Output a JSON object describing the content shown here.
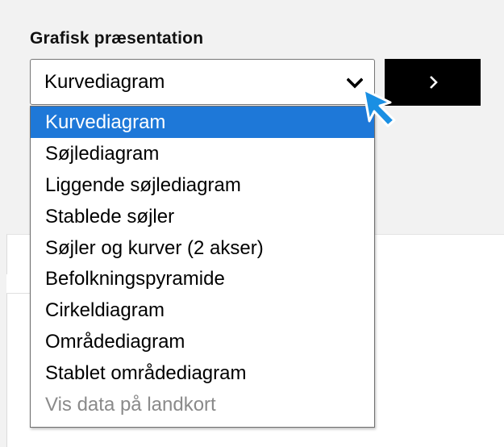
{
  "heading": "Grafisk præsentation",
  "select": {
    "value": "Kurvediagram",
    "chevron_icon": "chevron-down-icon"
  },
  "go_button": {
    "icon": "chevron-right-icon",
    "background": "#000000"
  },
  "dropdown": {
    "options": [
      {
        "label": "Kurvediagram",
        "state": "selected"
      },
      {
        "label": "Søjlediagram",
        "state": "enabled"
      },
      {
        "label": "Liggende søjlediagram",
        "state": "enabled"
      },
      {
        "label": "Stablede søjler",
        "state": "enabled"
      },
      {
        "label": "Søjler og kurver (2 akser)",
        "state": "enabled"
      },
      {
        "label": "Befolkningspyramide",
        "state": "enabled"
      },
      {
        "label": "Cirkeldiagram",
        "state": "enabled"
      },
      {
        "label": "Områdediagram",
        "state": "enabled"
      },
      {
        "label": "Stablet områdediagram",
        "state": "enabled"
      },
      {
        "label": "Vis data på landkort",
        "state": "disabled"
      }
    ]
  },
  "colors": {
    "selected_option": "#1e78d8",
    "cursor": "#1a8fe3",
    "disabled_text": "#8a8a8a"
  },
  "cursor_icon": "pointer-arrow-icon"
}
